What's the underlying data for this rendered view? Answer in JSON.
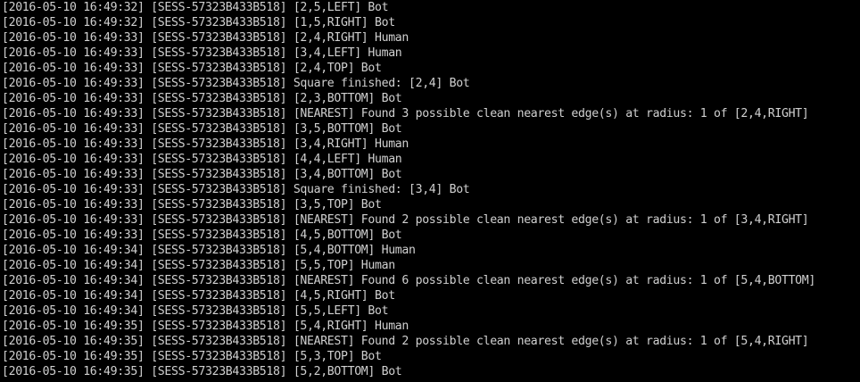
{
  "terminal": {
    "colors": {
      "background": "#000000",
      "foreground": "#d0d0d0"
    },
    "lines": [
      {
        "timestamp": "[2016-05-10 16:49:32]",
        "session": "[SESS-57323B433B518]",
        "message": "[2,5,LEFT] Bot"
      },
      {
        "timestamp": "[2016-05-10 16:49:32]",
        "session": "[SESS-57323B433B518]",
        "message": "[1,5,RIGHT] Bot"
      },
      {
        "timestamp": "[2016-05-10 16:49:33]",
        "session": "[SESS-57323B433B518]",
        "message": "[2,4,RIGHT] Human"
      },
      {
        "timestamp": "[2016-05-10 16:49:33]",
        "session": "[SESS-57323B433B518]",
        "message": "[3,4,LEFT] Human"
      },
      {
        "timestamp": "[2016-05-10 16:49:33]",
        "session": "[SESS-57323B433B518]",
        "message": "[2,4,TOP] Bot"
      },
      {
        "timestamp": "[2016-05-10 16:49:33]",
        "session": "[SESS-57323B433B518]",
        "message": "Square finished: [2,4] Bot"
      },
      {
        "timestamp": "[2016-05-10 16:49:33]",
        "session": "[SESS-57323B433B518]",
        "message": "[2,3,BOTTOM] Bot"
      },
      {
        "timestamp": "[2016-05-10 16:49:33]",
        "session": "[SESS-57323B433B518]",
        "message": "[NEAREST] Found 3 possible clean nearest edge(s) at radius: 1 of [2,4,RIGHT]"
      },
      {
        "timestamp": "[2016-05-10 16:49:33]",
        "session": "[SESS-57323B433B518]",
        "message": "[3,5,BOTTOM] Bot"
      },
      {
        "timestamp": "[2016-05-10 16:49:33]",
        "session": "[SESS-57323B433B518]",
        "message": "[3,4,RIGHT] Human"
      },
      {
        "timestamp": "[2016-05-10 16:49:33]",
        "session": "[SESS-57323B433B518]",
        "message": "[4,4,LEFT] Human"
      },
      {
        "timestamp": "[2016-05-10 16:49:33]",
        "session": "[SESS-57323B433B518]",
        "message": "[3,4,BOTTOM] Bot"
      },
      {
        "timestamp": "[2016-05-10 16:49:33]",
        "session": "[SESS-57323B433B518]",
        "message": "Square finished: [3,4] Bot"
      },
      {
        "timestamp": "[2016-05-10 16:49:33]",
        "session": "[SESS-57323B433B518]",
        "message": "[3,5,TOP] Bot"
      },
      {
        "timestamp": "[2016-05-10 16:49:33]",
        "session": "[SESS-57323B433B518]",
        "message": "[NEAREST] Found 2 possible clean nearest edge(s) at radius: 1 of [3,4,RIGHT]"
      },
      {
        "timestamp": "[2016-05-10 16:49:33]",
        "session": "[SESS-57323B433B518]",
        "message": "[4,5,BOTTOM] Bot"
      },
      {
        "timestamp": "[2016-05-10 16:49:34]",
        "session": "[SESS-57323B433B518]",
        "message": "[5,4,BOTTOM] Human"
      },
      {
        "timestamp": "[2016-05-10 16:49:34]",
        "session": "[SESS-57323B433B518]",
        "message": "[5,5,TOP] Human"
      },
      {
        "timestamp": "[2016-05-10 16:49:34]",
        "session": "[SESS-57323B433B518]",
        "message": "[NEAREST] Found 6 possible clean nearest edge(s) at radius: 1 of [5,4,BOTTOM]"
      },
      {
        "timestamp": "[2016-05-10 16:49:34]",
        "session": "[SESS-57323B433B518]",
        "message": "[4,5,RIGHT] Bot"
      },
      {
        "timestamp": "[2016-05-10 16:49:34]",
        "session": "[SESS-57323B433B518]",
        "message": "[5,5,LEFT] Bot"
      },
      {
        "timestamp": "[2016-05-10 16:49:35]",
        "session": "[SESS-57323B433B518]",
        "message": "[5,4,RIGHT] Human"
      },
      {
        "timestamp": "[2016-05-10 16:49:35]",
        "session": "[SESS-57323B433B518]",
        "message": "[NEAREST] Found 2 possible clean nearest edge(s) at radius: 1 of [5,4,RIGHT]"
      },
      {
        "timestamp": "[2016-05-10 16:49:35]",
        "session": "[SESS-57323B433B518]",
        "message": "[5,3,TOP] Bot"
      },
      {
        "timestamp": "[2016-05-10 16:49:35]",
        "session": "[SESS-57323B433B518]",
        "message": "[5,2,BOTTOM] Bot"
      }
    ]
  }
}
